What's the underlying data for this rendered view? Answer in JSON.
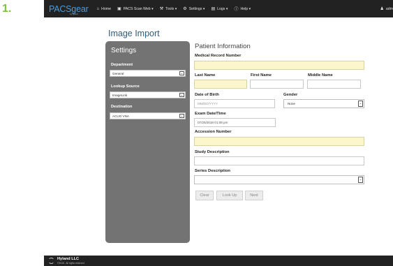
{
  "step_number": "1.",
  "navbar": {
    "logo": "PACSgear",
    "logo_sub": "by Hyland",
    "items": [
      {
        "icon": "home-icon",
        "glyph": "⌂",
        "label": "Home"
      },
      {
        "icon": "camera-icon",
        "glyph": "▣",
        "label": "PACS Scan Web ▾"
      },
      {
        "icon": "wrench-icon",
        "glyph": "⚒",
        "label": "Tools ▾"
      },
      {
        "icon": "gear-icon",
        "glyph": "⚙",
        "label": "Settings ▾"
      },
      {
        "icon": "book-icon",
        "glyph": "▤",
        "label": "Logs ▾"
      },
      {
        "icon": "help-icon",
        "glyph": "ⓘ",
        "label": "Help ▾"
      }
    ],
    "user": {
      "icon": "user-icon",
      "glyph": "♟",
      "label": "adm"
    }
  },
  "page_title": "Image Import",
  "settings": {
    "title": "Settings",
    "department": {
      "label": "Department",
      "value": "General"
    },
    "lookup_source": {
      "label": "Lookup Source",
      "value": "ImageLink"
    },
    "destination": {
      "label": "Destination",
      "value": "ACUO VNA"
    }
  },
  "form": {
    "title": "Patient Information",
    "mrn": {
      "label": "Medical Record Number",
      "value": ""
    },
    "last_name": {
      "label": "Last Name",
      "value": ""
    },
    "first_name": {
      "label": "First Name",
      "value": ""
    },
    "middle_name": {
      "label": "Middle Name",
      "value": ""
    },
    "dob": {
      "label": "Date of Birth",
      "placeholder": "MM/DD/YYYY"
    },
    "gender": {
      "label": "Gender",
      "value": "None"
    },
    "exam_datetime": {
      "label": "Exam Date/Time",
      "value": "07/25/2018 01:08 pm"
    },
    "accession": {
      "label": "Accession Number",
      "value": ""
    },
    "study_description": {
      "label": "Study Description",
      "value": ""
    },
    "series_description": {
      "label": "Series Description",
      "value": ""
    }
  },
  "buttons": {
    "clear": "Clear",
    "lookup": "Look Up",
    "next": "Next"
  },
  "footer": {
    "company": "Hyland LLC",
    "copyright": "©2018 . All rights reserved."
  },
  "colors": {
    "navbar": "#222222",
    "logo": "#4d9bd8",
    "panel": "#737373",
    "required_field": "#fbf6cb",
    "step": "#7cc242",
    "title": "#2f5c7a"
  }
}
